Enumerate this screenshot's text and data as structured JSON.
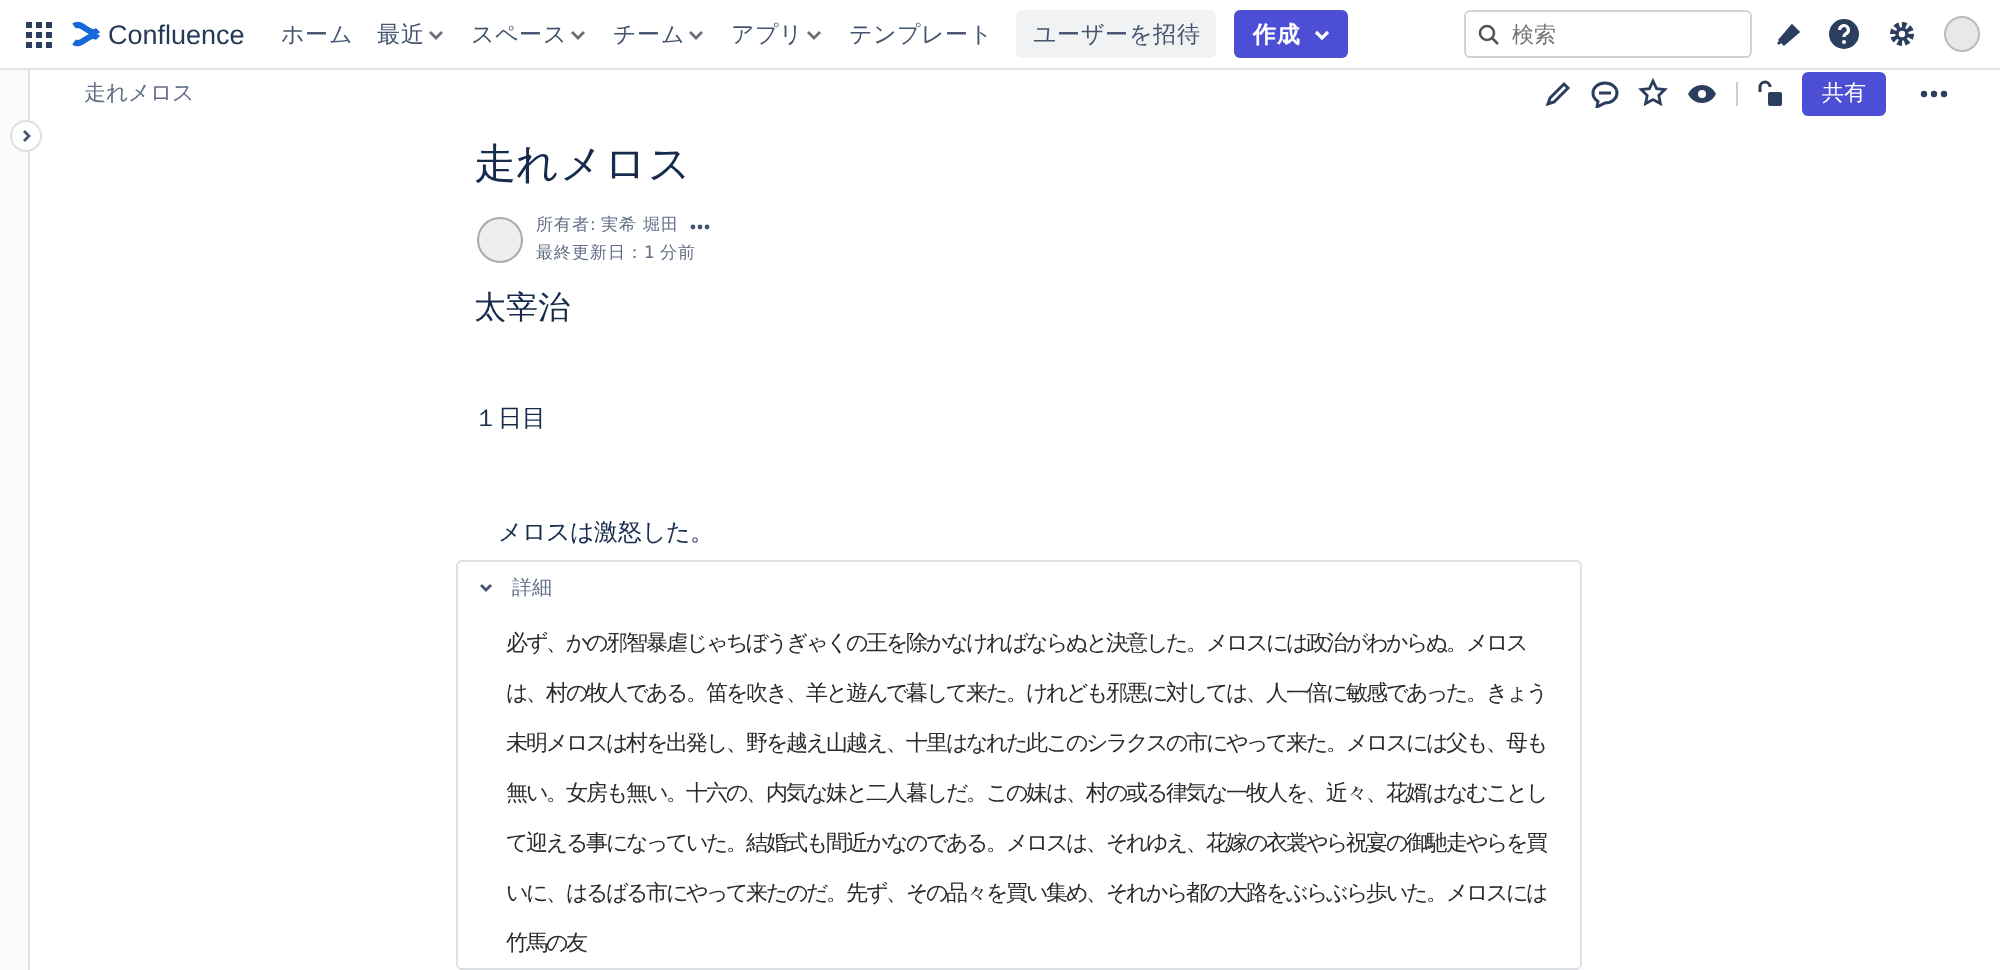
{
  "topbar": {
    "logo": "Confluence",
    "nav": [
      {
        "label": "ホーム",
        "dropdown": false
      },
      {
        "label": "最近",
        "dropdown": true
      },
      {
        "label": "スペース",
        "dropdown": true
      },
      {
        "label": "チーム",
        "dropdown": true
      },
      {
        "label": "アプリ",
        "dropdown": true
      },
      {
        "label": "テンプレート",
        "dropdown": false
      }
    ],
    "invite": "ユーザーを招待",
    "create": "作成",
    "search": {
      "placeholder": "検索"
    }
  },
  "breadcrumb": "走れメロス",
  "share": "共有",
  "page": {
    "title": "走れメロス",
    "owner": "所有者: 実希 堀田",
    "updated": "最終更新日：1 分前",
    "author": "太宰治",
    "heading": "１日目",
    "lead": "メロスは激怒した。",
    "expand": {
      "title": "詳細",
      "expanded": true,
      "text": "必ず、かの邪智暴虐じゃちぼうぎゃくの王を除かなければならぬと決意した。メロスには政治がわからぬ。メロスは、村の牧人である。笛を吹き、羊と遊んで暮して来た。けれども邪悪に対しては、人一倍に敏感であった。きょう未明メロスは村を出発し、野を越え山越え、十里はなれた此このシラクスの市にやって来た。メロスには父も、母も無い。女房も無い。十六の、内気な妹と二人暮しだ。この妹は、村の或る律気な一牧人を、近々、花婿はなむことして迎える事になっていた。結婚式も間近かなのである。メロスは、それゆえ、花嫁の衣裳やら祝宴の御馳走やらを買いに、はるばる市にやって来たのだ。先ず、その品々を買い集め、それから都の大路をぶらぶら歩いた。メロスには竹馬の友"
    }
  }
}
